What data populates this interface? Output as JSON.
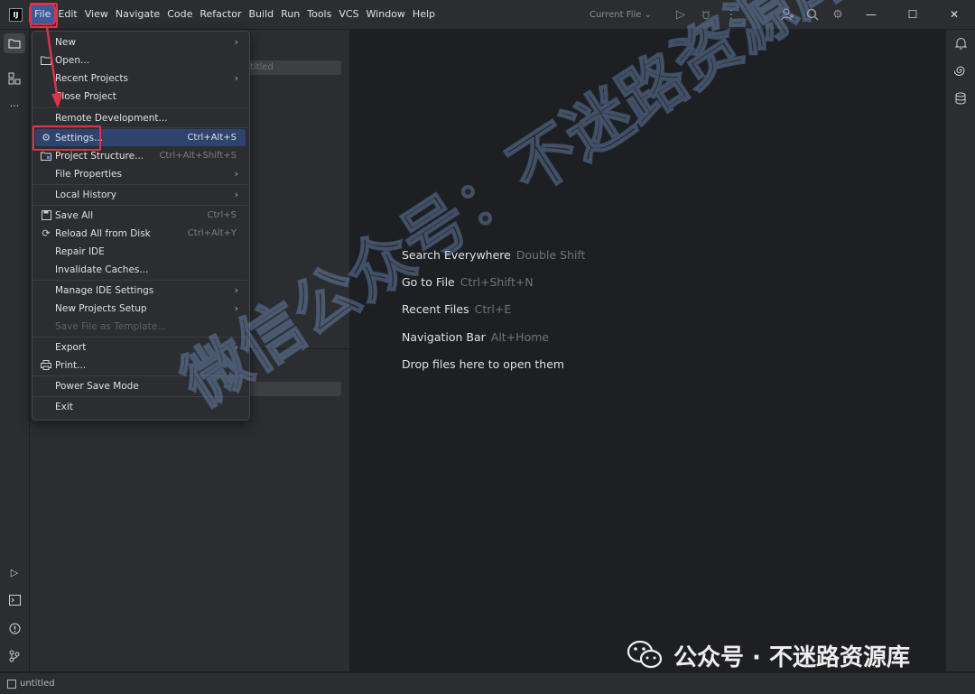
{
  "app": {
    "logo_text": "IJ"
  },
  "menubar": {
    "items": [
      {
        "label": "File"
      },
      {
        "label": "Edit"
      },
      {
        "label": "View"
      },
      {
        "label": "Navigate"
      },
      {
        "label": "Code"
      },
      {
        "label": "Refactor"
      },
      {
        "label": "Build"
      },
      {
        "label": "Run"
      },
      {
        "label": "Tools"
      },
      {
        "label": "VCS"
      },
      {
        "label": "Window"
      },
      {
        "label": "Help"
      }
    ]
  },
  "toolbar": {
    "run_config": "Current File ⌄"
  },
  "project_panel": {
    "search_placeholder": "titled"
  },
  "file_menu": {
    "items": [
      {
        "label": "New",
        "submenu": true
      },
      {
        "label": "Open...",
        "icon": "folder-icon"
      },
      {
        "label": "Recent Projects",
        "submenu": true
      },
      {
        "label": "Close Project"
      },
      {
        "label": "Remote Development..."
      },
      {
        "label": "Settings...",
        "shortcut": "Ctrl+Alt+S",
        "icon": "gear-icon"
      },
      {
        "label": "Project Structure...",
        "shortcut": "Ctrl+Alt+Shift+S",
        "icon": "project-structure-icon"
      },
      {
        "label": "File Properties",
        "submenu": true
      },
      {
        "label": "Local History",
        "submenu": true
      },
      {
        "label": "Save All",
        "shortcut": "Ctrl+S",
        "icon": "save-icon"
      },
      {
        "label": "Reload All from Disk",
        "shortcut": "Ctrl+Alt+Y",
        "icon": "reload-icon"
      },
      {
        "label": "Repair IDE"
      },
      {
        "label": "Invalidate Caches..."
      },
      {
        "label": "Manage IDE Settings",
        "submenu": true
      },
      {
        "label": "New Projects Setup",
        "submenu": true
      },
      {
        "label": "Save File as Template..."
      },
      {
        "label": "Export",
        "submenu": true
      },
      {
        "label": "Print...",
        "icon": "print-icon"
      },
      {
        "label": "Power Save Mode"
      },
      {
        "label": "Exit"
      }
    ]
  },
  "editor_hints": [
    {
      "label": "Search Everywhere",
      "key": "Double Shift"
    },
    {
      "label": "Go to File",
      "key": "Ctrl+Shift+N"
    },
    {
      "label": "Recent Files",
      "key": "Ctrl+E"
    },
    {
      "label": "Navigation Bar",
      "key": "Alt+Home"
    },
    {
      "label": "Drop files here to open them",
      "key": ""
    }
  ],
  "statusbar": {
    "project_name": "untitled"
  },
  "watermark": {
    "main_text": "微信公众号：不迷路资源库",
    "footer_text": "公众号 · 不迷路资源库"
  },
  "colors": {
    "background": "#1e1f22",
    "panel": "#2b2d30",
    "menu_selected": "#2e436e",
    "annotation_red": "#d9344b"
  }
}
